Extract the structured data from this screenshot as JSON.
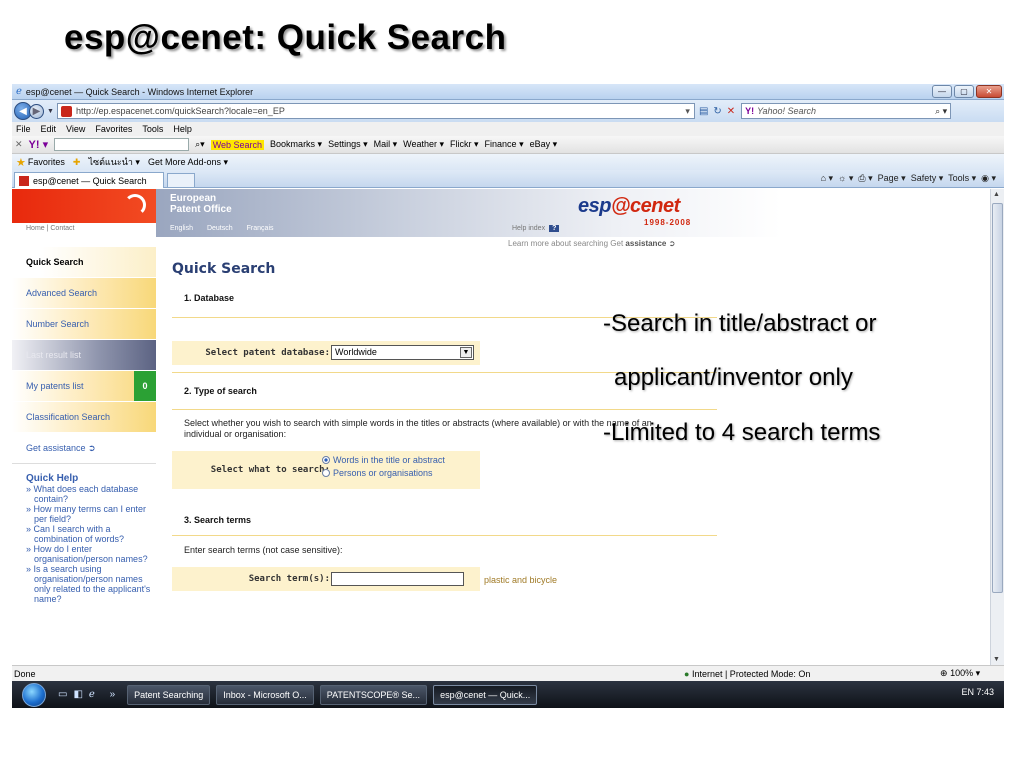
{
  "slide": {
    "title": "esp@cenet: Quick Search"
  },
  "window": {
    "title": "esp@cenet — Quick Search - Windows Internet Explorer",
    "controls": [
      "—",
      "▢",
      "✕"
    ]
  },
  "address": {
    "url": "http://ep.espacenet.com/quickSearch?locale=en_EP",
    "search_placeholder": "Yahoo! Search"
  },
  "menu": [
    "File",
    "Edit",
    "View",
    "Favorites",
    "Tools",
    "Help"
  ],
  "yahoo_toolbar": {
    "web_search": "Web Search",
    "items": [
      "Bookmarks ▾",
      "Settings ▾",
      "Mail ▾",
      "Weather ▾",
      "Flickr ▾",
      "Finance ▾",
      "eBay ▾"
    ]
  },
  "favorites_bar": {
    "label": "Favorites",
    "items": [
      "ไซต์แนะนำ ▾",
      "Get More Add-ons ▾"
    ]
  },
  "tab": {
    "title": "esp@cenet — Quick Search"
  },
  "command_bar": {
    "items": [
      "Page ▾",
      "Safety ▾",
      "Tools ▾"
    ]
  },
  "header": {
    "org_line1": "European",
    "org_line2": "Patent Office",
    "logo_esp": "esp",
    "logo_at": "@",
    "logo_cenet": "cenet",
    "logo_years": "1998-2008",
    "top_links": "Home | Contact",
    "languages": [
      "English",
      "Deutsch",
      "Français"
    ],
    "help_index": "Help index",
    "help_q": "?",
    "learn_text": "Learn more about searching Get",
    "learn_link": "assistance ➲"
  },
  "sidebar": {
    "items": [
      {
        "label": "Quick Search",
        "state": "active"
      },
      {
        "label": "Advanced Search",
        "state": "normal"
      },
      {
        "label": "Number Search",
        "state": "normal"
      },
      {
        "label": "Last result list",
        "state": "disabled"
      },
      {
        "label": "My patents list",
        "state": "normal",
        "count": "0"
      },
      {
        "label": "Classification Search",
        "state": "normal"
      },
      {
        "label": "Get assistance ➲",
        "state": "plain"
      }
    ]
  },
  "quick_help": {
    "title": "Quick Help",
    "items": [
      "» What does each database contain?",
      "» How many terms can I enter per field?",
      "» Can I search with a combination of words?",
      "» How do I enter organisation/person names?",
      "» Is a search using organisation/person names only related to the applicant's name?"
    ]
  },
  "main": {
    "title": "Quick Search",
    "section1": "1. Database",
    "db_label": "Select patent database:",
    "db_value": "Worldwide",
    "section2": "2. Type of search",
    "type_desc": "Select whether you wish to search with simple words in the titles or abstracts (where available) or with the name of an individual or organisation:",
    "type_label": "Select what to search:",
    "radio1": "Words in the title or abstract",
    "radio2": "Persons or organisations",
    "section3": "3. Search terms",
    "terms_desc": "Enter search terms (not case sensitive):",
    "terms_label": "Search term(s):",
    "terms_example": "plastic and bicycle"
  },
  "status": {
    "left": "Done",
    "zone": "Internet | Protected Mode: On",
    "zoom": "100% ▾"
  },
  "taskbar": {
    "buttons": [
      "Patent Searching",
      "Inbox - Microsoft O...",
      "PATENTSCOPE® Se...",
      "esp@cenet — Quick..."
    ],
    "tray": "EN  7:43"
  },
  "callouts": [
    "-Search in title/abstract or",
    "applicant/inventor only",
    "-Limited to 4 search terms"
  ]
}
